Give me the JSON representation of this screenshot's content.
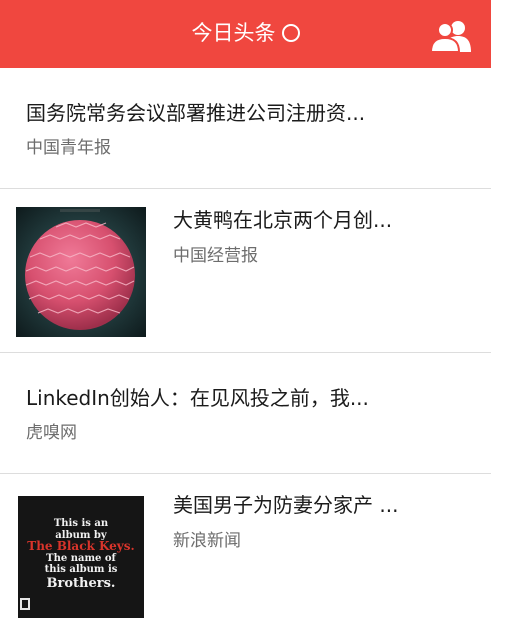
{
  "header": {
    "title": "今日头条",
    "loading_icon": "loading-circle-icon",
    "users_icon": "users-icon",
    "bg_color": "#f0473f"
  },
  "feed": [
    {
      "headline": "国务院常务会议部署推进公司注册资...",
      "source": "中国青年报"
    },
    {
      "headline": "大黄鸭在北京两个月创...",
      "source": "中国经营报",
      "thumbnail": "pink-lantern-album-cover"
    },
    {
      "headline": "LinkedIn创始人：在见风投之前，我...",
      "source": "虎嗅网"
    },
    {
      "headline": "美国男子为防妻分家产 ...",
      "source": "新浪新闻",
      "thumbnail": "black-keys-brothers-album-cover",
      "thumbnail_text": {
        "line1": "This is an",
        "line2": "album by",
        "line3": "The Black Keys.",
        "line4": "The name of",
        "line5": "this album is",
        "line6": "Brothers."
      }
    }
  ]
}
